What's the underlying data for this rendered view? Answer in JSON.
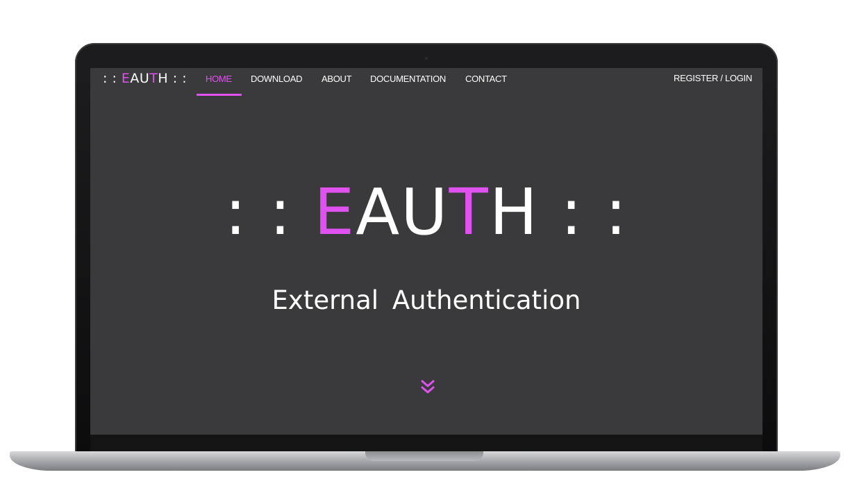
{
  "brand": {
    "prefix": ": : ",
    "e": "E",
    "au": "AU",
    "t": "T",
    "h": "H",
    "suffix": " : :"
  },
  "nav": {
    "items": [
      "HOME",
      "DOWNLOAD",
      "ABOUT",
      "DOCUMENTATION",
      "CONTACT"
    ],
    "active": "HOME",
    "auth_link": "REGISTER / LOGIN"
  },
  "hero": {
    "prefix": ": : ",
    "e": "E",
    "au": "AU",
    "t": "T",
    "h": "H",
    "suffix": " : :",
    "subtitle": "External  Authentication"
  },
  "icons": {
    "scroll": "double-chevron-down-icon"
  },
  "colors": {
    "accent": "#e052f0",
    "background": "#3a393b",
    "text": "#ffffff"
  }
}
